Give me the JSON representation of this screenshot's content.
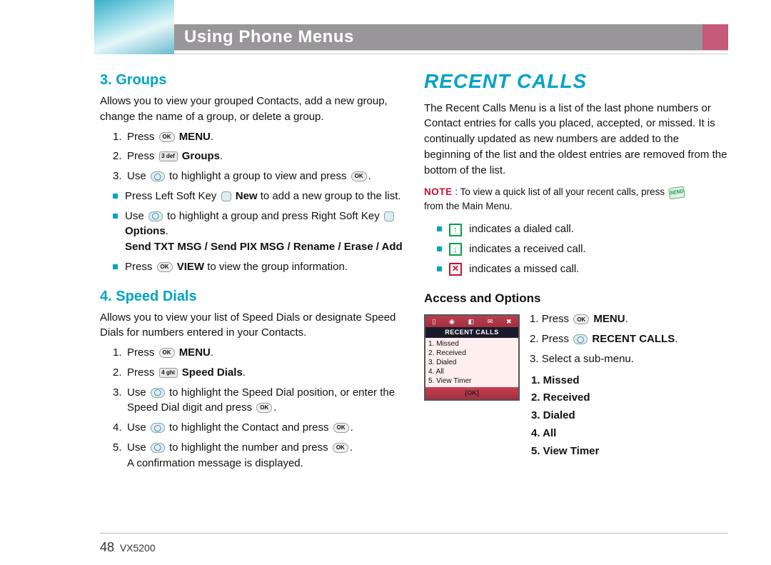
{
  "header": {
    "title": "Using Phone Menus"
  },
  "col1": {
    "sec1": {
      "heading": "3. Groups",
      "intro": "Allows you to view your grouped Contacts, add a new group, change the name of a group, or delete a group.",
      "step1a": "Press ",
      "step1b": "MENU",
      "step1c": ".",
      "step2a": "Press ",
      "step2b": "Groups",
      "step2c": ".",
      "step3a": "Use ",
      "step3b": " to highlight a group to view and press ",
      "step3c": ".",
      "b1a": "Press Left Soft Key ",
      "b1b": "New",
      "b1c": " to add a new group to the list.",
      "b2a": "Use ",
      "b2b": " to highlight a group and press Right Soft Key ",
      "b2opt": "Options",
      "b2dot": ".",
      "b2sub": "Send TXT MSG / Send PIX MSG / Rename / Erase / Add",
      "b3a": "Press ",
      "b3b": "VIEW",
      "b3c": " to view the group information."
    },
    "sec2": {
      "heading": "4. Speed Dials",
      "intro": "Allows you to view your list of Speed Dials or designate Speed Dials for numbers entered in your Contacts.",
      "s1a": "Press ",
      "s1b": "MENU",
      "s1c": ".",
      "s2a": "Press ",
      "s2b": "Speed Dials",
      "s2c": ".",
      "s3a": "Use ",
      "s3b": " to highlight the Speed Dial position, or enter the Speed Dial digit and press ",
      "s3c": ".",
      "s4a": "Use ",
      "s4b": " to highlight the Contact and press ",
      "s4c": ".",
      "s5a": "Use ",
      "s5b": " to highlight the number and press ",
      "s5c": ".",
      "s5d": "A confirmation message is displayed."
    }
  },
  "col2": {
    "bigHeading": "RECENT CALLS",
    "intro": "The Recent Calls Menu is a list of the last phone numbers or Contact entries for calls you placed, accepted, or missed. It is continually updated as new numbers are added to the beginning of the list and the oldest entries are removed from the bottom of the list.",
    "noteLabel": "NOTE",
    "noteText1": " : To view a quick list of all your recent calls, press ",
    "noteText2": "from the Main Menu.",
    "ind1": " indicates a dialed call.",
    "ind2": " indicates a received call.",
    "ind3": " indicates a missed call.",
    "accessHeading": "Access and Options",
    "phone": {
      "title": "RECENT CALLS",
      "rows": [
        "1. Missed",
        "2. Received",
        "3. Dialed",
        "4. All",
        "5. View Timer"
      ],
      "ok": "[OK]"
    },
    "a1a": "Press ",
    "a1b": "MENU",
    "a1c": ".",
    "a2a": "Press ",
    "a2b": "RECENT CALLS",
    "a2c": ".",
    "a3": "Select a sub-menu.",
    "sub": [
      "1. Missed",
      "2. Received",
      "3. Dialed",
      "4. All",
      "5. View Timer"
    ]
  },
  "keys": {
    "ok": "OK",
    "k3": "3 def",
    "k4": "4 ghi",
    "send": "SEND"
  },
  "footer": {
    "pageNum": "48",
    "model": "VX5200"
  }
}
